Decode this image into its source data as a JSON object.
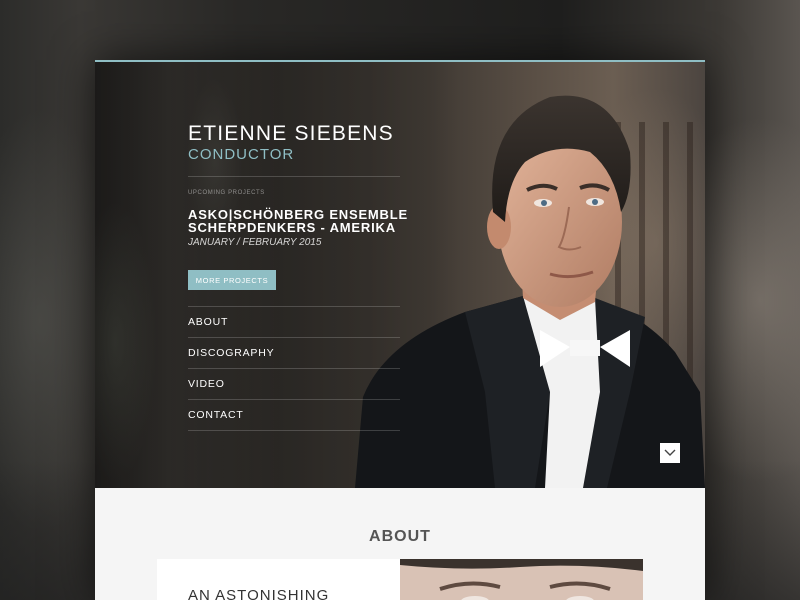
{
  "hero": {
    "name": "ETIENNE SIEBENS",
    "role": "CONDUCTOR",
    "upcoming_label": "UPCOMING PROJECTS",
    "project_line1": "ASKO|SCHÖNBERG ENSEMBLE",
    "project_line2": "SCHERPDENKERS - AMERIKA",
    "project_date": "JANUARY / FEBRUARY 2015",
    "more_button": "MORE PROJECTS",
    "scroll_icon": "chevron-down-icon"
  },
  "nav": {
    "items": [
      {
        "label": "ABOUT"
      },
      {
        "label": "DISCOGRAPHY"
      },
      {
        "label": "VIDEO"
      },
      {
        "label": "CONTACT"
      }
    ]
  },
  "about": {
    "heading": "ABOUT",
    "teaser": "AN ASTONISHING"
  },
  "colors": {
    "accent": "#8fbec4",
    "hero_text": "#ffffff",
    "section_bg": "#f5f5f5"
  }
}
